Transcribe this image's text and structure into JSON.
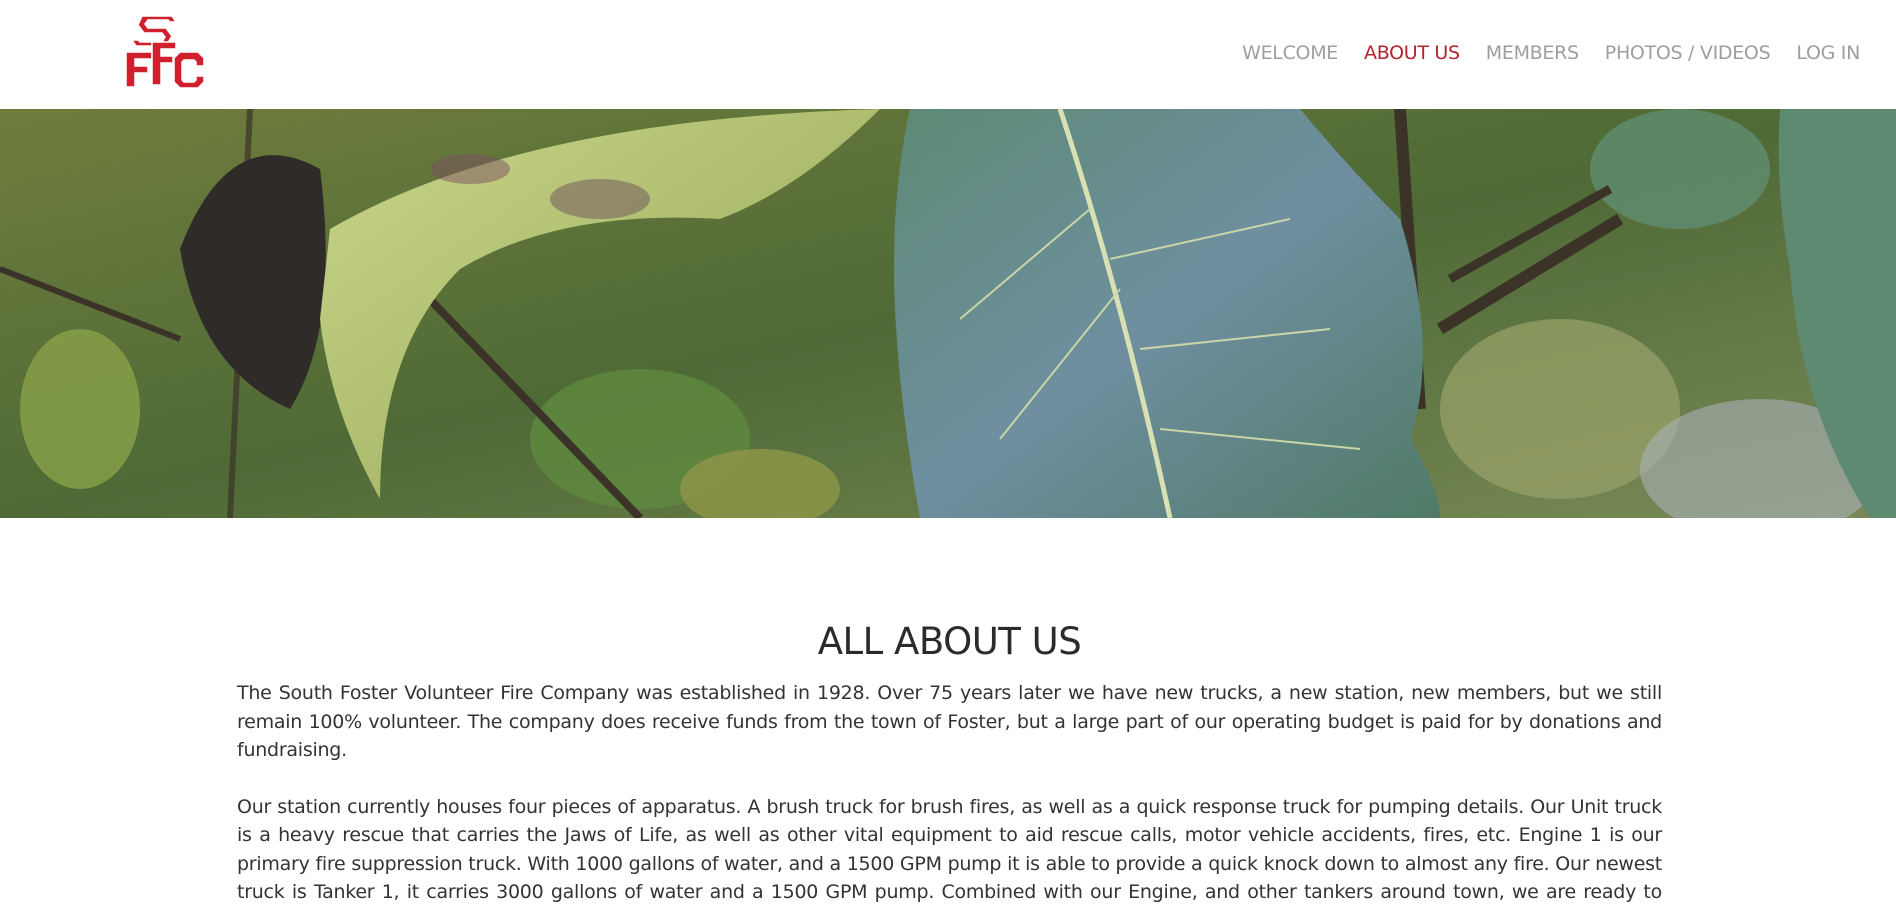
{
  "logo": {
    "text": "SFFC",
    "color": "#d0202e",
    "icon": "fire-company-monogram"
  },
  "nav": {
    "items": [
      {
        "label": "WELCOME",
        "active": false
      },
      {
        "label": "ABOUT US",
        "active": true
      },
      {
        "label": "MEMBERS",
        "active": false
      },
      {
        "label": "PHOTOS / VIDEOS",
        "active": false
      },
      {
        "label": "LOG IN",
        "active": false
      }
    ],
    "active_color": "#b1262c",
    "inactive_color": "#9e9e9e"
  },
  "hero": {
    "subject": "leaves-photo"
  },
  "main": {
    "title": "ALL ABOUT US",
    "paragraphs": [
      "The South Foster Volunteer Fire Company was established in 1928. Over 75 years later we have new trucks, a new station, new members, but we still remain 100% volunteer. The company does receive funds from the town of Foster, but a large part of our operating budget is paid for by donations and fundraising.",
      "Our station currently houses four pieces of apparatus. A brush truck for brush fires, as well as a quick response truck for pumping details. Our Unit truck is a heavy rescue that carries the Jaws of Life, as well as other vital equipment to aid rescue calls, motor vehicle accidents, fires, etc. Engine 1 is our primary fire suppression truck. With 1000 gallons of water, and a 1500 GPM pump it is able to provide a quick knock down to almost any fire. Our newest truck is Tanker 1, it carries 3000 gallons of water and a 1500 GPM pump. Combined with our Engine, and other tankers around town, we are ready to handle much larger fires."
    ]
  }
}
